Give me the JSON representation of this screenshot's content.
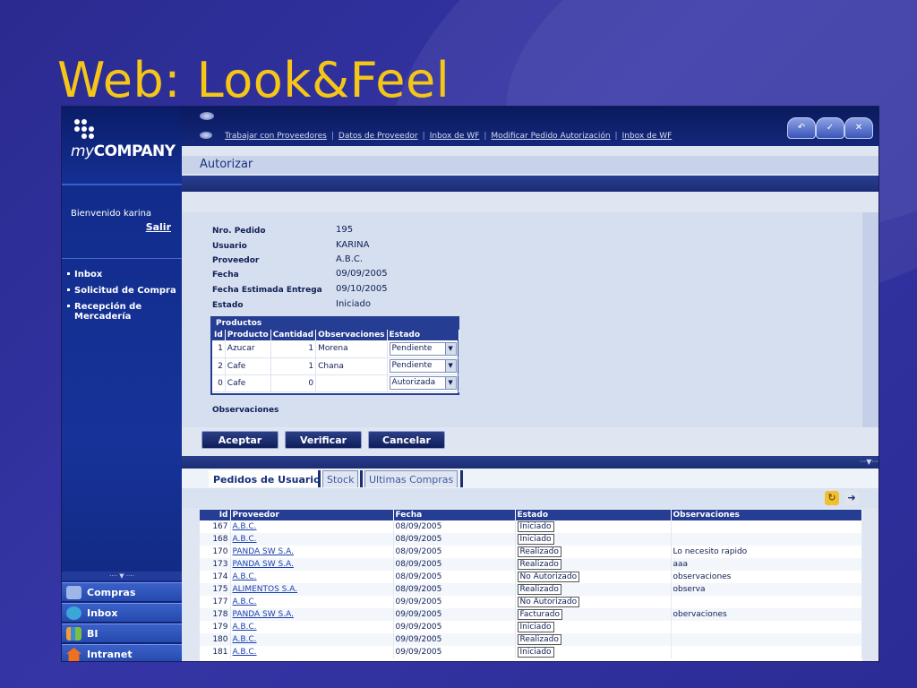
{
  "slide_title": "Web: Look&Feel",
  "logo": {
    "prefix": "my",
    "name": "COMPANY"
  },
  "sidebar": {
    "welcome": "Bienvenido karina",
    "logout": "Salir",
    "links": [
      "Inbox",
      "Solicitud de Compra",
      "Recepción de Mercadería"
    ],
    "splitter": "···· ▼ ····",
    "apps": [
      {
        "label": "Compras",
        "icon": "shopping-icon",
        "color": "#9fb7e8"
      },
      {
        "label": "Inbox",
        "icon": "globe-icon",
        "color": "#3aa7d8"
      },
      {
        "label": "BI",
        "icon": "bar-chart-icon",
        "color": "#f0a030"
      },
      {
        "label": "Intranet",
        "icon": "home-icon",
        "color": "#f07020"
      }
    ]
  },
  "toplinks": [
    "Trabajar con Proveedores",
    "Datos de Proveedor",
    "Inbox de WF",
    "Modificar Pedido Autorización",
    "Inbox de WF"
  ],
  "page_header": "Autorizar",
  "form": {
    "fields": [
      {
        "label": "Nro. Pedido",
        "value": "195"
      },
      {
        "label": "Usuario",
        "value": "KARINA"
      },
      {
        "label": "Proveedor",
        "value": "A.B.C."
      },
      {
        "label": "Fecha",
        "value": "09/09/2005"
      },
      {
        "label": "Fecha Estimada Entrega",
        "value": "09/10/2005"
      },
      {
        "label": "Estado",
        "value": "Iniciado"
      }
    ],
    "products_caption": "Productos",
    "products_headers": [
      "Id",
      "Producto",
      "Cantidad",
      "Observaciones",
      "Estado"
    ],
    "products": [
      {
        "id": "1",
        "producto": "Azucar",
        "cantidad": "1",
        "obs": "Morena",
        "estado": "Pendiente"
      },
      {
        "id": "2",
        "producto": "Cafe",
        "cantidad": "1",
        "obs": "Chana",
        "estado": "Pendiente"
      },
      {
        "id": "0",
        "producto": "Cafe",
        "cantidad": "0",
        "obs": "",
        "estado": "Autorizada"
      }
    ],
    "observaciones_label": "Observaciones"
  },
  "actions": {
    "accept": "Aceptar",
    "verify": "Verificar",
    "cancel": "Cancelar"
  },
  "tabs": [
    "Pedidos de Usuario",
    "Stock",
    "Ultimas Compras"
  ],
  "lower_strip_dots": "···▼···",
  "orders": {
    "headers": [
      "Id",
      "Proveedor",
      "Fecha",
      "Estado",
      "Observaciones"
    ],
    "rows": [
      {
        "id": "167",
        "proveedor": "A.B.C.",
        "fecha": "08/09/2005",
        "estado": "Iniciado",
        "obs": ""
      },
      {
        "id": "168",
        "proveedor": "A.B.C.",
        "fecha": "08/09/2005",
        "estado": "Iniciado",
        "obs": ""
      },
      {
        "id": "170",
        "proveedor": "PANDA SW S.A.",
        "fecha": "08/09/2005",
        "estado": "Realizado",
        "obs": "Lo necesito rapido"
      },
      {
        "id": "173",
        "proveedor": "PANDA SW S.A.",
        "fecha": "08/09/2005",
        "estado": "Realizado",
        "obs": "aaa"
      },
      {
        "id": "174",
        "proveedor": "A.B.C.",
        "fecha": "08/09/2005",
        "estado": "No Autorizado",
        "obs": "observaciones"
      },
      {
        "id": "175",
        "proveedor": "ALIMENTOS S.A.",
        "fecha": "08/09/2005",
        "estado": "Realizado",
        "obs": "observa"
      },
      {
        "id": "177",
        "proveedor": "A.B.C.",
        "fecha": "09/09/2005",
        "estado": "No Autorizado",
        "obs": ""
      },
      {
        "id": "178",
        "proveedor": "PANDA SW S.A.",
        "fecha": "09/09/2005",
        "estado": "Facturado",
        "obs": "obervaciones"
      },
      {
        "id": "179",
        "proveedor": "A.B.C.",
        "fecha": "09/09/2005",
        "estado": "Iniciado",
        "obs": ""
      },
      {
        "id": "180",
        "proveedor": "A.B.C.",
        "fecha": "09/09/2005",
        "estado": "Realizado",
        "obs": ""
      },
      {
        "id": "181",
        "proveedor": "A.B.C.",
        "fecha": "09/09/2005",
        "estado": "Iniciado",
        "obs": ""
      }
    ]
  },
  "colors": {
    "title": "#f5c518",
    "accent": "#253d93",
    "background": "#2f2f9a"
  }
}
